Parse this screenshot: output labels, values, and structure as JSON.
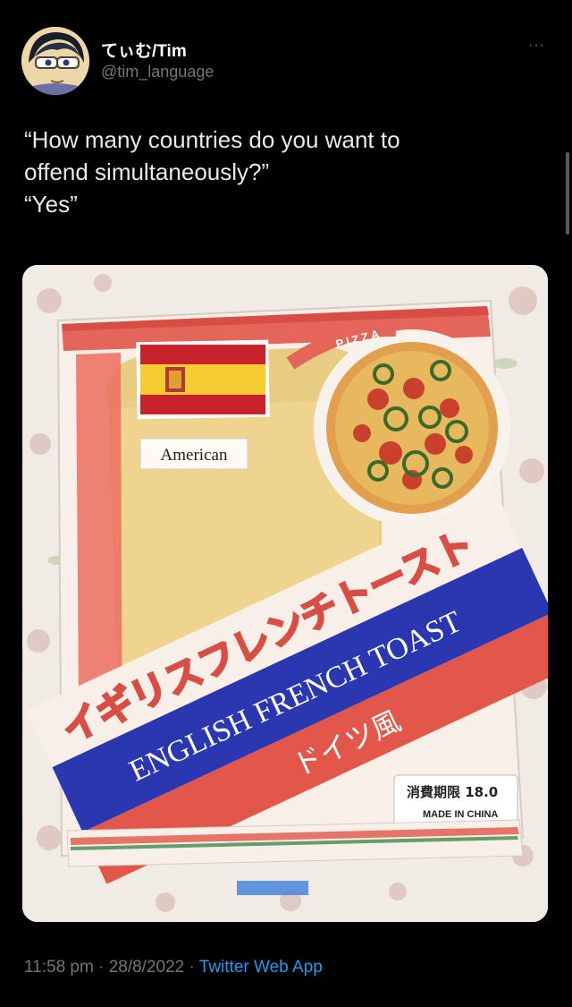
{
  "user": {
    "display_name": "てぃむ/Tim",
    "handle": "@tim_language"
  },
  "more_menu": {
    "label": "···"
  },
  "tweet": {
    "lines": [
      "“How many countries do you want to",
      "offend simultaneously?”",
      "“Yes”"
    ]
  },
  "media": {
    "package": {
      "tag_label": "American",
      "pizza_label": "PIZZA",
      "japanese_title": "イギリスフレンチトースト",
      "english_title": "ENGLISH FRENCH TOAST",
      "style_label": "ドイツ風",
      "expiry_label": "消費期限 18.0",
      "origin_label": "MADE IN CHINA"
    }
  },
  "footer": {
    "time": "11:58 pm",
    "separator": " · ",
    "date": "28/8/2022",
    "source": "Twitter Web App"
  },
  "colors": {
    "background": "#000000",
    "text": "#e7e9ea",
    "secondary": "#71767b",
    "link": "#1d9bf0",
    "package_red": "#e2574a",
    "package_blue": "#2a37b0"
  },
  "icons": [
    "avatar",
    "more-icon"
  ]
}
